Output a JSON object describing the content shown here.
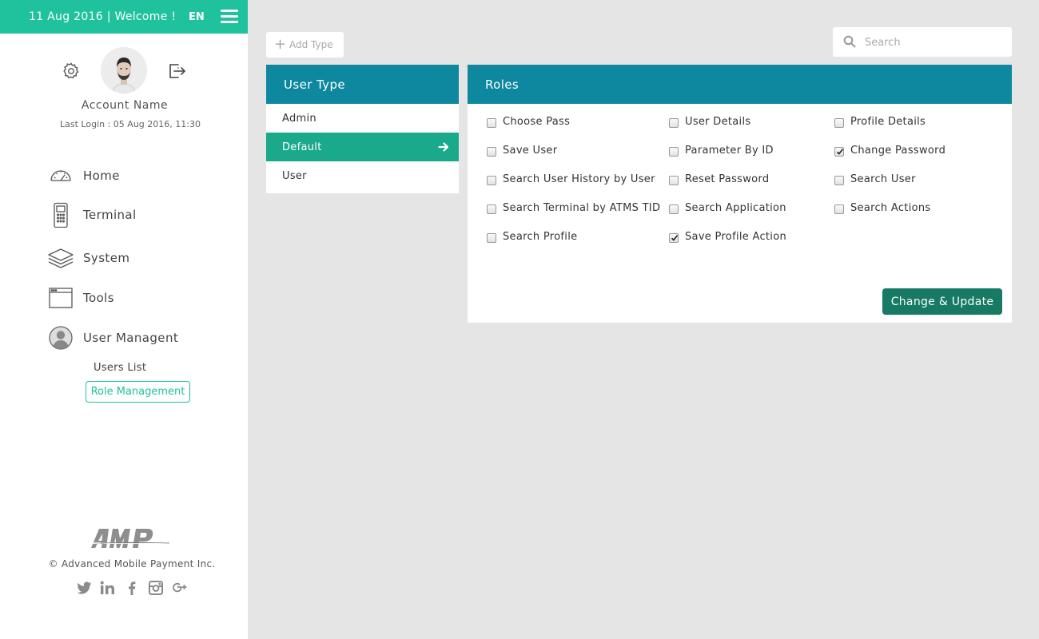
{
  "header": {
    "welcome": "11 Aug 2016 | Welcome !",
    "language": "EN"
  },
  "profile": {
    "account_name": "Account Name",
    "last_login": "Last Login : 05 Aug 2016, 11:30"
  },
  "nav": {
    "items": [
      {
        "label": "Home",
        "icon": "dashboard-gauge-icon"
      },
      {
        "label": "Terminal",
        "icon": "payment-terminal-icon"
      },
      {
        "label": "System",
        "icon": "layers-icon"
      },
      {
        "label": "Tools",
        "icon": "window-icon"
      },
      {
        "label": "User Managent",
        "icon": "user-circle-icon"
      }
    ],
    "sub_items": [
      {
        "label": "Users List"
      },
      {
        "label": "Role Management",
        "active": true
      }
    ]
  },
  "footer": {
    "copyright": "© Advanced Mobile Payment Inc.",
    "social": [
      "twitter-icon",
      "linkedin-icon",
      "facebook-icon",
      "instagram-icon",
      "google-plus-icon"
    ]
  },
  "toolbar": {
    "add_type_label": "Add Type",
    "search_placeholder": "Search"
  },
  "user_type_panel": {
    "title": "User Type",
    "items": [
      {
        "label": "Admin",
        "selected": false
      },
      {
        "label": "Default",
        "selected": true
      },
      {
        "label": "User",
        "selected": false
      }
    ]
  },
  "roles_panel": {
    "title": "Roles",
    "roles": [
      {
        "label": "Choose Pass",
        "checked": false
      },
      {
        "label": "User Details",
        "checked": false
      },
      {
        "label": "Profile Details",
        "checked": false
      },
      {
        "label": "Save User",
        "checked": false
      },
      {
        "label": "Parameter By ID",
        "checked": false
      },
      {
        "label": "Change Password",
        "checked": true
      },
      {
        "label": "Search User History by User",
        "checked": false
      },
      {
        "label": "Reset Password",
        "checked": false
      },
      {
        "label": "Search User",
        "checked": false
      },
      {
        "label": "Search Terminal by ATMS TID",
        "checked": false
      },
      {
        "label": "Search Application",
        "checked": false
      },
      {
        "label": "Search Actions",
        "checked": false
      },
      {
        "label": "Search Profile",
        "checked": false
      },
      {
        "label": "Save Profile Action",
        "checked": true
      }
    ],
    "update_label": "Change & Update"
  },
  "colors": {
    "accent_green": "#1fc29d",
    "header_teal": "#0e889e",
    "selected_row": "#1aa98a",
    "button_dark_green": "#167a64"
  }
}
